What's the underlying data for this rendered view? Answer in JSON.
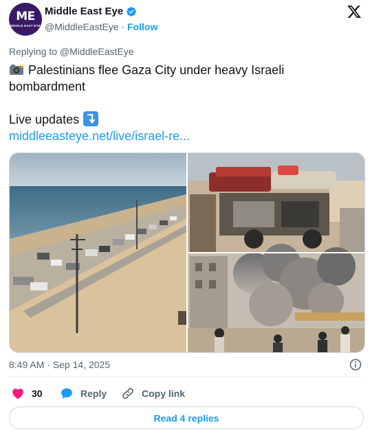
{
  "account": {
    "name": "Middle East Eye",
    "handle": "@MiddleEastEye",
    "separator": "·",
    "follow_label": "Follow",
    "avatar_mark": "ME",
    "avatar_small": "MIDDLE EAST EYE"
  },
  "reply_context": "Replying to @MiddleEastEye",
  "tweet": {
    "line1": "Palestinians flee Gaza City under heavy Israeli",
    "line2": "bombardment",
    "live_updates": "Live updates",
    "link": "middleeasteye.net/live/israel-re..."
  },
  "timestamp": "8:49 AM · Sep 14, 2025",
  "actions": {
    "like_count": "30",
    "reply_label": "Reply",
    "copy_link_label": "Copy link"
  },
  "read_replies_label": "Read 4 replies",
  "colors": {
    "accent": "#1d9bf0",
    "like": "#f91880",
    "text_secondary": "#536471",
    "avatar_bg": "#3a1a66"
  },
  "icons": [
    "verified-badge-icon",
    "x-logo-icon",
    "camera-flash-icon",
    "arrow-turn-down-icon",
    "heart-icon",
    "reply-bubble-icon",
    "link-icon",
    "info-icon"
  ]
}
